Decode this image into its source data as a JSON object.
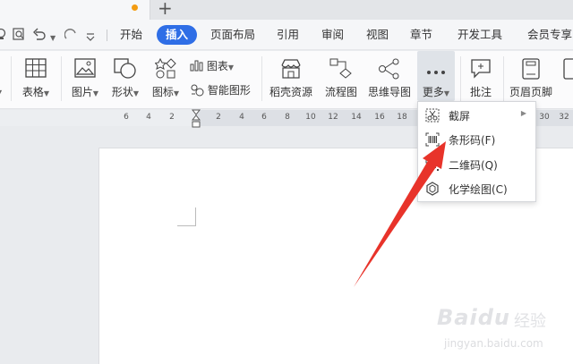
{
  "menubar": {
    "items": [
      "开始",
      "插入",
      "页面布局",
      "引用",
      "审阅",
      "视图",
      "章节",
      "开发工具",
      "会员专享"
    ],
    "active": "插入"
  },
  "ribbon": {
    "table": "表格",
    "picture": "图片",
    "shape": "形状",
    "icon": "图标",
    "chart": "图表",
    "smart_graphic": "智能图形",
    "docer_resource": "稻壳资源",
    "flowchart": "流程图",
    "mindmap": "思维导图",
    "more": "更多",
    "comment": "批注",
    "header_footer": "页眉页脚"
  },
  "ruler": {
    "left_ticks": [
      "6",
      "4",
      "2"
    ],
    "right_ticks": [
      "2",
      "4",
      "6",
      "8",
      "10",
      "12",
      "14",
      "16",
      "18",
      "30",
      "32"
    ]
  },
  "dropdown": {
    "items": [
      {
        "label": "截屏",
        "has_submenu": true
      },
      {
        "label": "条形码(F)"
      },
      {
        "label": "二维码(Q)"
      },
      {
        "label": "化学绘图(C)"
      }
    ]
  },
  "watermark": {
    "brand": "Baidu",
    "word": "经验",
    "url": "jingyan.baidu.com"
  },
  "colors": {
    "accent": "#2f6ee6",
    "unsaved": "#f39c12",
    "annotation_arrow": "#e8332a"
  }
}
